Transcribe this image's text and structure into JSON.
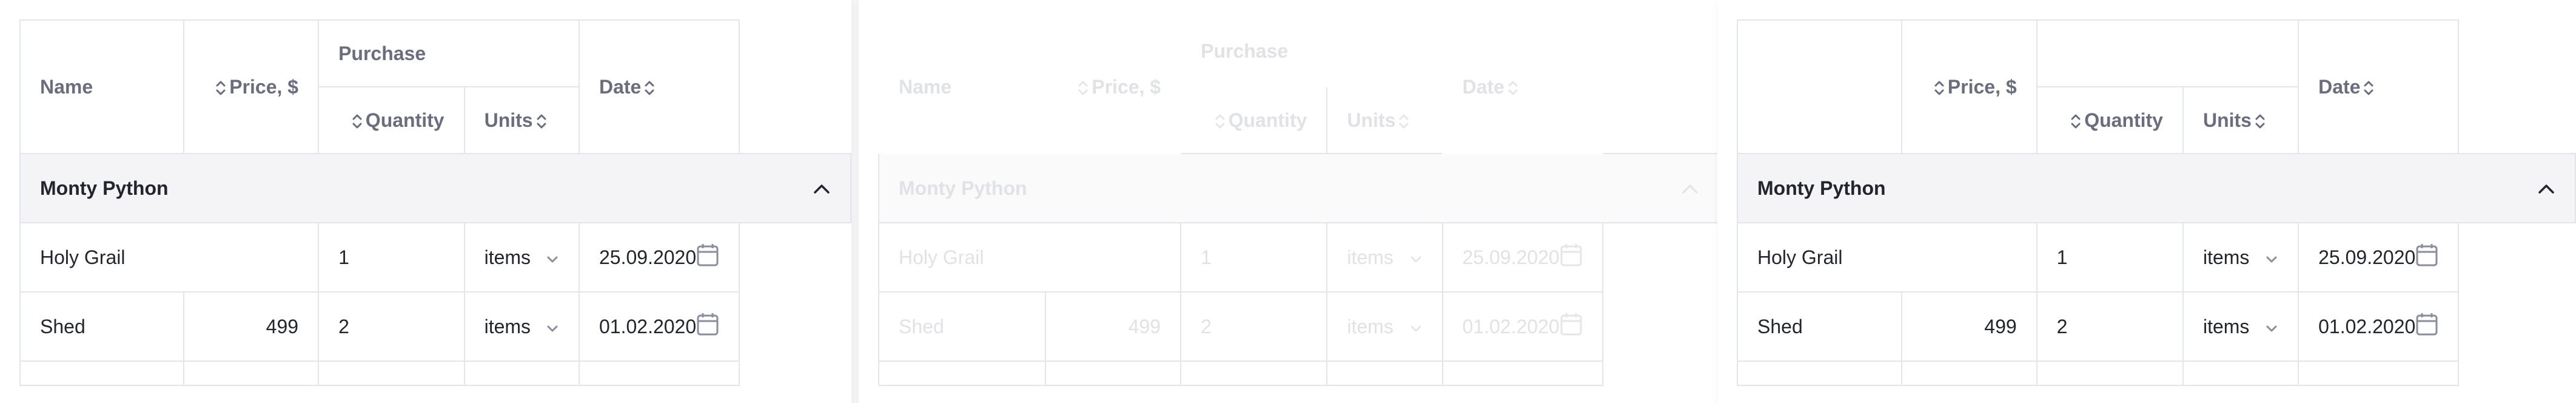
{
  "columns": {
    "name": "Name",
    "price": "Price, $",
    "purchase": "Purchase",
    "quantity": "Quantity",
    "units": "Units",
    "date": "Date"
  },
  "group": {
    "label": "Monty Python"
  },
  "rows": [
    {
      "name": "Holy Grail",
      "price": "",
      "quantity": "1",
      "units": "items",
      "date": "25.09.2020"
    },
    {
      "name": "Shed",
      "price": "499",
      "quantity": "2",
      "units": "items",
      "date": "01.02.2020"
    }
  ],
  "colors": {
    "accent": "#e64a05",
    "border": "#e4e5ea",
    "header_text": "#6a6d7d",
    "group_bg": "#f4f4f6"
  },
  "icons": [
    "sort-icon",
    "chevron-up-icon",
    "chevron-down-icon",
    "calendar-icon"
  ]
}
